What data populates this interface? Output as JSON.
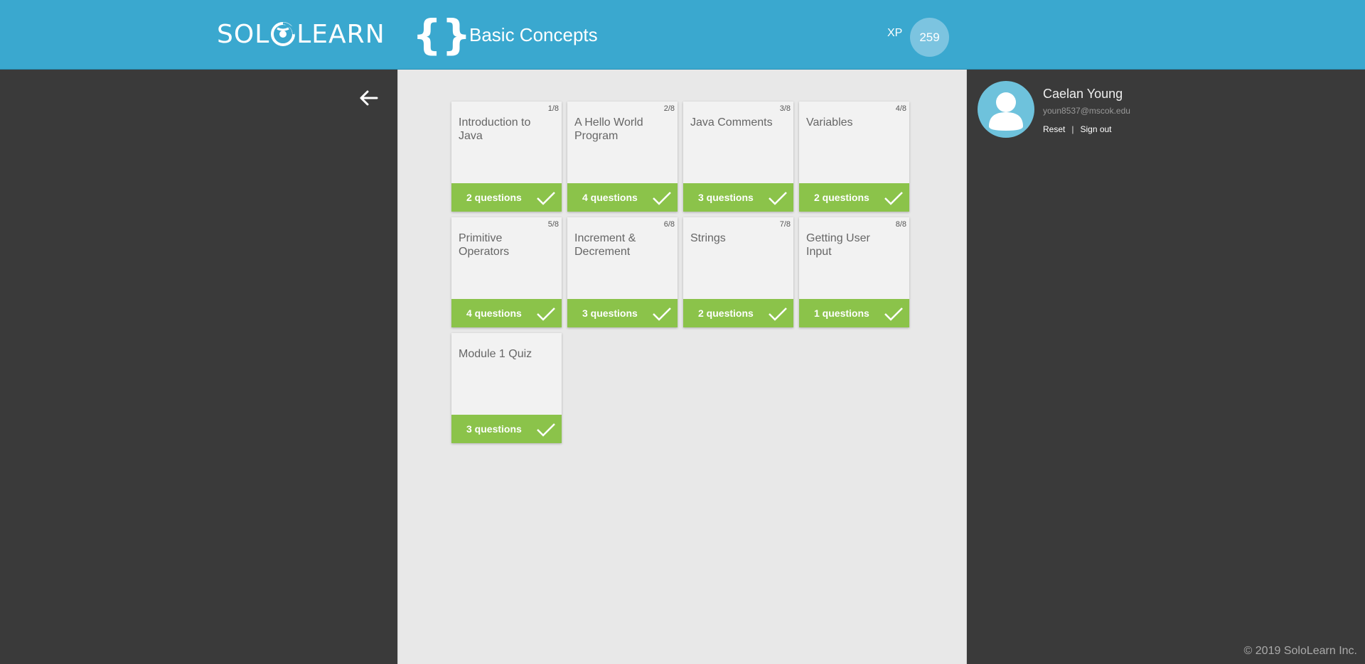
{
  "header": {
    "logo_left": "SOL",
    "logo_right": "LEARN",
    "braces": "{}",
    "course_title": "Basic Concepts",
    "xp_label": "XP",
    "xp_value": "259"
  },
  "lessons": [
    {
      "num": "1/8",
      "title": "Introduction to Java",
      "questions": "2 questions",
      "completed": true
    },
    {
      "num": "2/8",
      "title": "A Hello World Program",
      "questions": "4 questions",
      "completed": true
    },
    {
      "num": "3/8",
      "title": "Java Comments",
      "questions": "3 questions",
      "completed": true
    },
    {
      "num": "4/8",
      "title": "Variables",
      "questions": "2 questions",
      "completed": true
    },
    {
      "num": "5/8",
      "title": "Primitive Operators",
      "questions": "4 questions",
      "completed": true
    },
    {
      "num": "6/8",
      "title": "Increment & Decrement",
      "questions": "3 questions",
      "completed": true
    },
    {
      "num": "7/8",
      "title": "Strings",
      "questions": "2 questions",
      "completed": true
    },
    {
      "num": "8/8",
      "title": "Getting User Input",
      "questions": "1 questions",
      "completed": true
    },
    {
      "num": "",
      "title": "Module 1 Quiz",
      "questions": "3 questions",
      "completed": true
    }
  ],
  "user": {
    "name": "Caelan Young",
    "email": "youn8537@mscok.edu",
    "reset_label": "Reset",
    "separator": "|",
    "signout_label": "Sign out"
  },
  "footer": {
    "copyright": "© 2019 SoloLearn Inc."
  },
  "colors": {
    "header_bg": "#3aa8cf",
    "sidebar_bg": "#3a3a3a",
    "content_bg": "#e8e8e8",
    "card_bg": "#f2f2f2",
    "complete_green": "#8bc34a",
    "avatar_bg": "#6ec2dc"
  },
  "icons": {
    "back": "arrow-left-icon",
    "check": "checkmark-icon",
    "avatar": "user-silhouette-icon",
    "logo": "sololearn-swirl-icon"
  }
}
